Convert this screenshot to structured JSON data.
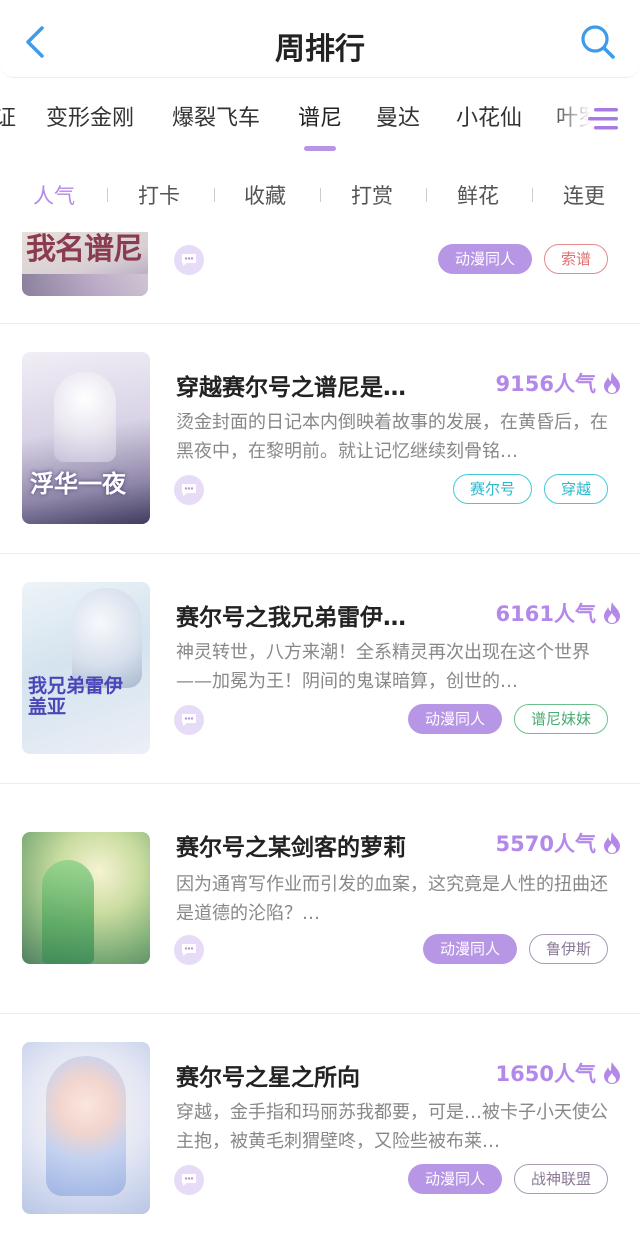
{
  "header": {
    "title": "周排行",
    "back_icon": "chevron-left-icon",
    "search_icon": "search-icon",
    "accent": "#3d9be9"
  },
  "categories": {
    "items": [
      "证",
      "变形金刚",
      "爆裂飞车",
      "谱尼",
      "曼达",
      "小花仙",
      "叶罗"
    ],
    "active": "谱尼",
    "menu_icon": "menu-list-icon"
  },
  "sort_tabs": {
    "items": [
      "人气",
      "打卡",
      "收藏",
      "打赏",
      "鲜花",
      "连更"
    ],
    "active": "人气",
    "active_color": "#b388e8"
  },
  "books": [
    {
      "cover_text": "我名谱尼",
      "tags": [
        {
          "label": "动漫同人",
          "style": "filled"
        },
        {
          "label": "索谱",
          "style": "red"
        }
      ]
    },
    {
      "title": "穿越赛尔号之谱尼是…",
      "popularity": "9156人气",
      "desc": "烫金封面的日记本内倒映着故事的发展，在黄昏后，在黑夜中，在黎明前。就让记忆继续刻骨铭…",
      "cover_text": "浮华一夜",
      "tags": [
        {
          "label": "赛尔号",
          "style": "cyan"
        },
        {
          "label": "穿越",
          "style": "cyan"
        }
      ]
    },
    {
      "title": "赛尔号之我兄弟雷伊…",
      "popularity": "6161人气",
      "desc": "神灵转世，八方来潮！全系精灵再次出现在这个世界——加冕为王！阴间的鬼谋暗算，创世的…",
      "cover_text": "我兄弟雷伊盖亚",
      "tags": [
        {
          "label": "动漫同人",
          "style": "filled"
        },
        {
          "label": "谱尼妹妹",
          "style": "green"
        }
      ]
    },
    {
      "title": "赛尔号之某剑客的萝莉",
      "popularity": "5570人气",
      "desc": "因为通宵写作业而引发的血案，这究竟是人性的扭曲还是道德的沦陷？…",
      "tags": [
        {
          "label": "动漫同人",
          "style": "filled"
        },
        {
          "label": "鲁伊斯",
          "style": "gray"
        }
      ]
    },
    {
      "title": "赛尔号之星之所向",
      "popularity": "1650人气",
      "desc": "穿越，金手指和玛丽苏我都要，可是…被卡子小天使公主抱，被黄毛刺猬壁咚，又险些被布莱…",
      "tags": [
        {
          "label": "动漫同人",
          "style": "filled"
        },
        {
          "label": "战神联盟",
          "style": "gray"
        }
      ]
    }
  ],
  "icons": {
    "fire": "fire-icon",
    "comment": "comment-icon"
  },
  "colors": {
    "tag_filled": "#b896e6",
    "popularity": "#b388e8"
  }
}
